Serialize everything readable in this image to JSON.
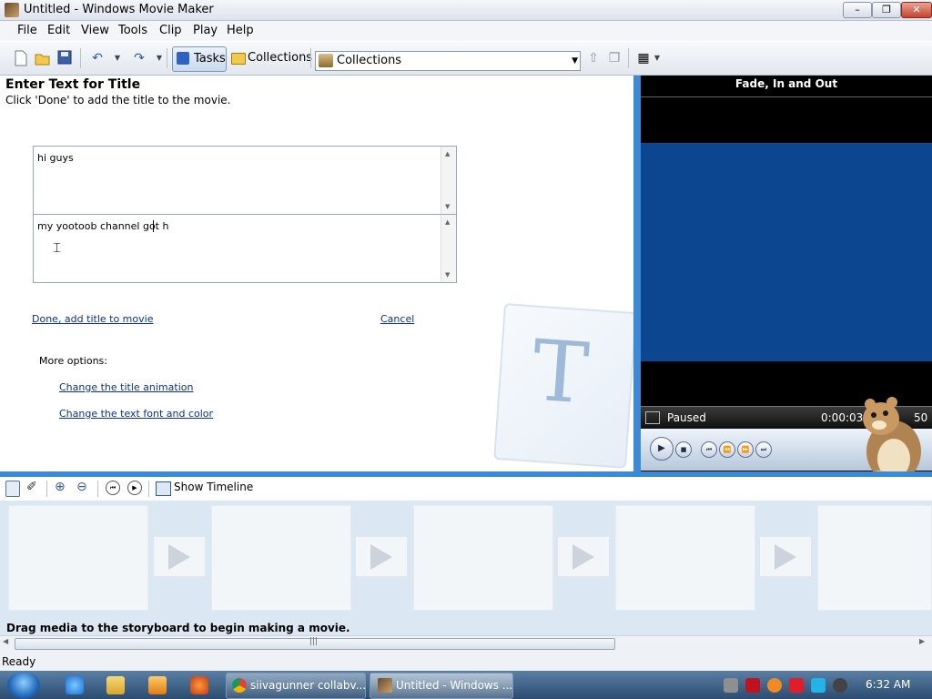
{
  "window": {
    "title": "Untitled - Windows Movie Maker",
    "min_glyph": "–",
    "max_glyph": "❐",
    "close_glyph": "✕"
  },
  "menu": [
    "File",
    "Edit",
    "View",
    "Tools",
    "Clip",
    "Play",
    "Help"
  ],
  "toolbar": {
    "tasks_label": "Tasks",
    "collections_label": "Collections",
    "collections_combo_value": "Collections"
  },
  "task_pane": {
    "title": "Enter Text for Title",
    "subtitle": "Click 'Done' to add the title to the movie.",
    "text_line1": "hi guys",
    "text_line2": "my yootoob channel got h",
    "done_link": "Done, add title to movie",
    "cancel_link": "Cancel",
    "more_options_label": "More options:",
    "option_animation": "Change the title animation",
    "option_font": "Change the text font and color",
    "watermark_letter": "T"
  },
  "monitor": {
    "title": "Fade, In and Out",
    "status": "Paused",
    "time": "0:00:03.47",
    "duration_fragment": "50"
  },
  "storyboard": {
    "show_timeline_label": "Show Timeline",
    "hint": "Drag media to the storyboard to begin making a movie.",
    "scroll_grip": "|||"
  },
  "status_bar": {
    "text": "Ready"
  },
  "taskbar": {
    "apps": [
      {
        "label": "siivagunner collabv..."
      },
      {
        "label": "Untitled - Windows ..."
      }
    ],
    "clock": "6:32 AM"
  },
  "colors": {
    "accent_blue": "#3c8ad6",
    "monitor_screen": "#0d4690",
    "link": "#0b2f9e"
  }
}
